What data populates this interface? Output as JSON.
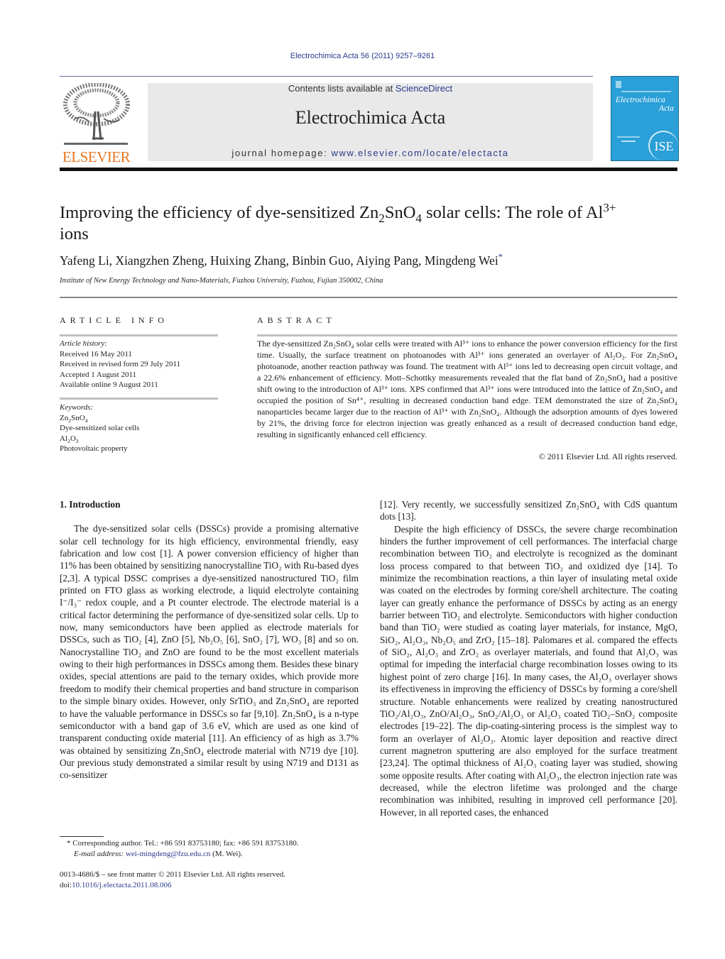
{
  "header": {
    "citation": "Electrochimica Acta 56 (2011) 9257–9261",
    "contents_prefix": "Contents lists available at ",
    "contents_link": "ScienceDirect",
    "journal_name": "Electrochimica Acta",
    "homepage_prefix": "journal homepage: ",
    "homepage_link": "www.elsevier.com/locate/electacta",
    "publisher_logo_text": "ELSEVIER",
    "cover": {
      "line1": "Electrochimica",
      "line2": "Acta",
      "seal": "ISE",
      "color": "#2a9fd8"
    },
    "brand_color": "#e87722",
    "link_color": "#2a3a8c"
  },
  "article": {
    "title_part1": "Improving the efficiency of dye-sensitized Zn",
    "title_sub1": "2",
    "title_part2": "SnO",
    "title_sub2": "4",
    "title_part3": " solar cells: The role of Al",
    "title_sup": "3+",
    "title_part4": " ions",
    "authors": "Yafeng Li, Xiangzhen Zheng, Huixing Zhang, Binbin Guo, Aiying Pang, Mingdeng Wei",
    "corresponding_mark": "*",
    "affiliation": "Institute of New Energy Technology and Nano-Materials, Fuzhou University, Fuzhou, Fujian 350002, China"
  },
  "article_info": {
    "heading": "ARTICLE INFO",
    "history_label": "Article history:",
    "history": [
      "Received 16 May 2011",
      "Received in revised form 29 July 2011",
      "Accepted 1 August 2011",
      "Available online 9 August 2011"
    ],
    "keywords_label": "Keywords:",
    "keywords": [
      "Zn2SnO4",
      "Dye-sensitized solar cells",
      "Al2O3",
      "Photovoltaic property"
    ]
  },
  "abstract": {
    "heading": "ABSTRACT",
    "text": "The dye-sensitized Zn₂SnO₄ solar cells were treated with Al³⁺ ions to enhance the power conversion efficiency for the first time. Usually, the surface treatment on photoanodes with Al³⁺ ions generated an overlayer of Al₂O₃. For Zn₂SnO₄ photoanode, another reaction pathway was found. The treatment with Al³⁺ ions led to decreasing open circuit voltage, and a 22.6% enhancement of efficiency. Mott–Schottky measurements revealed that the flat band of Zn₂SnO₄ had a positive shift owing to the introduction of Al³⁺ ions. XPS confirmed that Al³⁺ ions were introduced into the lattice of Zn₂SnO₄ and occupied the position of Sn⁴⁺, resulting in decreased conduction band edge. TEM demonstrated the size of Zn₂SnO₄ nanoparticles became larger due to the reaction of Al³⁺ with Zn₂SnO₄. Although the adsorption amounts of dyes lowered by 21%, the driving force for electron injection was greatly enhanced as a result of decreased conduction band edge, resulting in significantly enhanced cell efficiency.",
    "copyright": "© 2011 Elsevier Ltd. All rights reserved."
  },
  "body": {
    "section_heading": "1.  Introduction",
    "left_paragraphs": [
      "The dye-sensitized solar cells (DSSCs) provide a promising alternative solar cell technology for its high efficiency, environmental friendly, easy fabrication and low cost [1]. A power conversion efficiency of higher than 11% has been obtained by sensitizing nanocrystalline TiO₂ with Ru-based dyes [2,3]. A typical DSSC comprises a dye-sensitized nanostructured TiO₂ film printed on FTO glass as working electrode, a liquid electrolyte containing I⁻/I₃⁻ redox couple, and a Pt counter electrode. The electrode material is a critical factor determining the performance of dye-sensitized solar cells. Up to now, many semiconductors have been applied as electrode materials for DSSCs, such as TiO₂ [4], ZnO [5], Nb₂O₅ [6], SnO₂ [7], WO₃ [8] and so on. Nanocrystalline TiO₂ and ZnO are found to be the most excellent materials owing to their high performances in DSSCs among them. Besides these binary oxides, special attentions are paid to the ternary oxides, which provide more freedom to modify their chemical properties and band structure in comparison to the simple binary oxides. However, only SrTiO₃ and Zn₂SnO₄ are reported to have the valuable performance in DSSCs so far [9,10]. Zn₂SnO₄ is a n-type semiconductor with a band gap of 3.6 eV, which are used as one kind of transparent conducting oxide material [11]. An efficiency of as high as 3.7% was obtained by sensitizing Zn₂SnO₄ electrode material with N719 dye [10]. Our previous study demonstrated a similar result by using N719 and D131 as co-sensitizer"
    ],
    "right_paragraphs": [
      "[12]. Very recently, we successfully sensitized Zn₂SnO₄ with CdS quantum dots [13].",
      "Despite the high efficiency of DSSCs, the severe charge recombination hinders the further improvement of cell performances. The interfacial charge recombination between TiO₂ and electrolyte is recognized as the dominant loss process compared to that between TiO₂ and oxidized dye [14]. To minimize the recombination reactions, a thin layer of insulating metal oxide was coated on the electrodes by forming core/shell architecture. The coating layer can greatly enhance the performance of DSSCs by acting as an energy barrier between TiO₂ and electrolyte. Semiconductors with higher conduction band than TiO₂ were studied as coating layer materials, for instance, MgO, SiO₂, Al₂O₃, Nb₂O₅ and ZrO₂ [15–18]. Palomares et al. compared the effects of SiO₂, Al₂O₃ and ZrO₂ as overlayer materials, and found that Al₂O₃ was optimal for impeding the interfacial charge recombination losses owing to its highest point of zero charge [16]. In many cases, the Al₂O₃ overlayer shows its effectiveness in improving the efficiency of DSSCs by forming a core/shell structure. Notable enhancements were realized by creating nanostructured TiO₂/Al₂O₃, ZnO/Al₂O₃, SnO₂/Al₂O₃ or Al₂O₃ coated TiO₂–SnO₂ composite electrodes [19–22]. The dip-coating-sintering process is the simplest way to form an overlayer of Al₂O₃. Atomic layer deposition and reactive direct current magnetron sputtering are also employed for the surface treatment [23,24]. The optimal thickness of Al₂O₃ coating layer was studied, showing some opposite results. After coating with Al₂O₃, the electron injection rate was decreased, while the electron lifetime was prolonged and the charge recombination was inhibited, resulting in improved cell performance [20]. However, in all reported cases, the enhanced"
    ]
  },
  "footnotes": {
    "corresponding": "* Corresponding author. Tel.: +86 591 83753180; fax: +86 591 83753180.",
    "email_label": "E-mail address: ",
    "email": "wei-mingdeng@fzu.edu.cn",
    "email_suffix": " (M. Wei).",
    "front_matter": "0013-4686/$ – see front matter © 2011 Elsevier Ltd. All rights reserved.",
    "doi_prefix": "doi:",
    "doi": "10.1016/j.electacta.2011.08.006"
  }
}
